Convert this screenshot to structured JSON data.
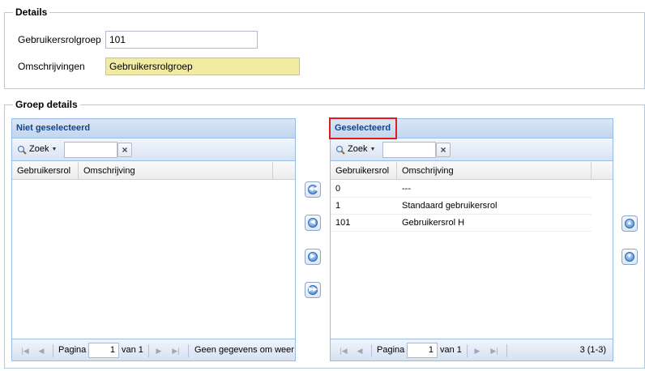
{
  "details": {
    "legend": "Details",
    "field1_label": "Gebruikersrolgroep",
    "field1_value": "101",
    "field2_label": "Omschrijvingen",
    "field2_value": "Gebruikersrolgroep"
  },
  "groep": {
    "legend": "Groep details"
  },
  "left_grid": {
    "title": "Niet geselecteerd",
    "search_label": "Zoek",
    "columns": [
      "Gebruikersrol",
      "Omschrijving"
    ],
    "pager": {
      "page_label": "Pagina",
      "page": "1",
      "of_label": "van 1",
      "status": "Geen gegevens om weer"
    }
  },
  "right_grid": {
    "title": "Geselecteerd",
    "search_label": "Zoek",
    "columns": [
      "Gebruikersrol",
      "Omschrijving"
    ],
    "rows": [
      {
        "rol": "0",
        "omschrijving": "---"
      },
      {
        "rol": "1",
        "omschrijving": "Standaard gebruikersrol"
      },
      {
        "rol": "101",
        "omschrijving": "Gebruikersrol H"
      }
    ],
    "pager": {
      "page_label": "Pagina",
      "page": "1",
      "of_label": "van 1",
      "status": "3 (1-3)"
    }
  },
  "icons": {
    "move_all_left": "double-left-arrow-icon",
    "move_left": "left-arrow-icon",
    "move_right": "right-arrow-icon",
    "move_all_right": "double-right-arrow-icon",
    "move_up": "up-arrow-icon",
    "move_down": "down-arrow-icon",
    "search": "magnifier-icon",
    "clear": "clear-x-icon"
  },
  "colors": {
    "highlight": "#e01b1b",
    "readonly_field": "#f2eba3",
    "panel_title": "#15428b"
  }
}
